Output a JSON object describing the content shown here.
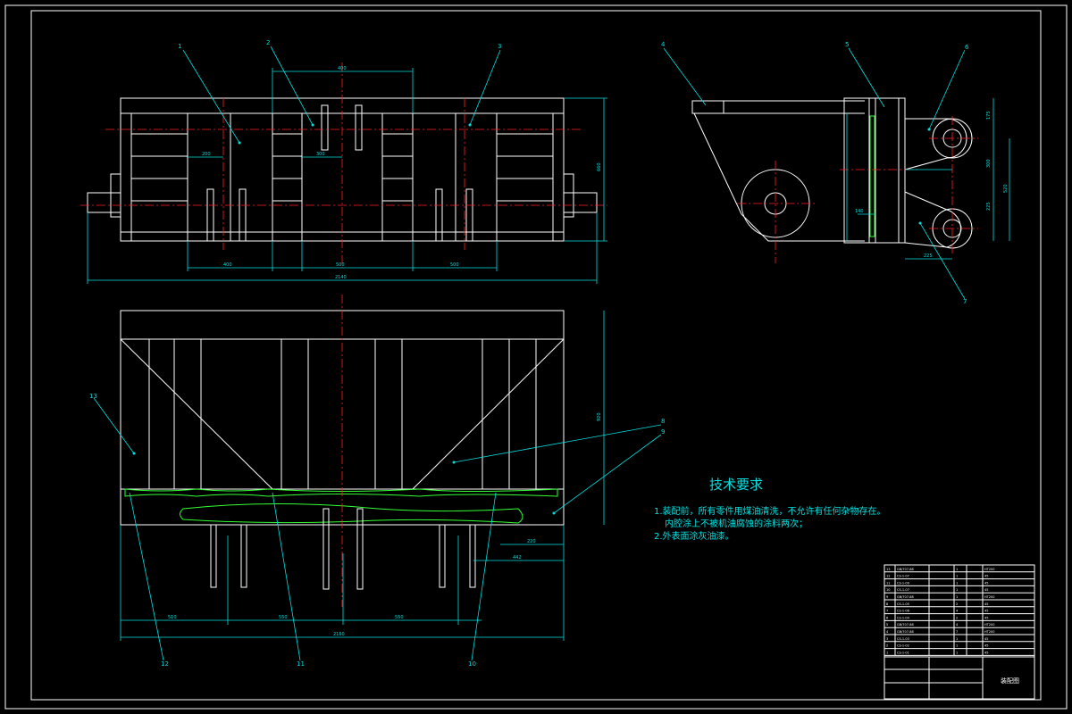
{
  "technical_requirements": {
    "title": "技术要求",
    "lines": [
      "1.装配前，所有零件用煤油清洗，不允许有任何杂物存在。",
      "内腔涂上不被机油腐蚀的涂料两次；",
      "2.外表面涂灰油漆。"
    ]
  },
  "part_labels": [
    "1",
    "2",
    "3",
    "4",
    "5",
    "6",
    "7",
    "8",
    "9",
    "10",
    "11",
    "12",
    "13"
  ],
  "dimensions": {
    "front_top": "400",
    "front_small_1": "200",
    "front_small_2": "300",
    "front_bottom_1": "400",
    "front_bottom_2": "500",
    "front_bottom_3": "500",
    "front_overall": "2140",
    "front_height": "660",
    "side_1": "175",
    "side_2": "300",
    "side_3": "225",
    "side_4": "140",
    "side_overall_h": "520",
    "side_bottom": "225",
    "bottom_total": "2160",
    "bottom_seg_1": "510",
    "bottom_seg_2": "550",
    "bottom_seg_3": "550",
    "bottom_right": "442",
    "bottom_right_2": "220",
    "plan_height": "920"
  },
  "title_block": {
    "drawing_name": "装配图",
    "parts": [
      {
        "no": "13",
        "code": "GB/707-88",
        "name": "",
        "qty": "1",
        "mat": "HT200"
      },
      {
        "no": "12",
        "code": "CS-1-07",
        "name": "",
        "qty": "1",
        "mat": "45"
      },
      {
        "no": "11",
        "code": "CS-1-09",
        "name": "",
        "qty": "1",
        "mat": "45"
      },
      {
        "no": "10",
        "code": "CS-1-07",
        "name": "",
        "qty": "1",
        "mat": "45"
      },
      {
        "no": "9",
        "code": "GB/707-88",
        "name": "",
        "qty": "1",
        "mat": "HT200"
      },
      {
        "no": "8",
        "code": "CS-1-05",
        "name": "",
        "qty": "2",
        "mat": "45"
      },
      {
        "no": "7",
        "code": "CS-1-06",
        "name": "",
        "qty": "4",
        "mat": "45"
      },
      {
        "no": "6",
        "code": "CS-1-04",
        "name": "",
        "qty": "2",
        "mat": "45"
      },
      {
        "no": "5",
        "code": "GB/707-88",
        "name": "",
        "qty": "4",
        "mat": "HT200"
      },
      {
        "no": "4",
        "code": "GB/707-88",
        "name": "",
        "qty": "7",
        "mat": "HT200"
      },
      {
        "no": "3",
        "code": "CS-1-03",
        "name": "",
        "qty": "1",
        "mat": "45"
      },
      {
        "no": "2",
        "code": "CS-1-02",
        "name": "",
        "qty": "1",
        "mat": "45"
      },
      {
        "no": "1",
        "code": "CS-1-01",
        "name": "",
        "qty": "1",
        "mat": "45"
      }
    ]
  },
  "colors": {
    "background": "#000000",
    "outline": "#ffffff",
    "dimension": "#00e0e0",
    "centerline": "#ff2020",
    "weld": "#33ff33"
  }
}
